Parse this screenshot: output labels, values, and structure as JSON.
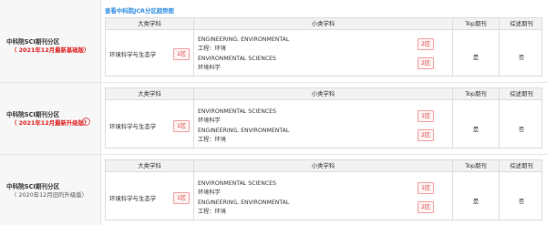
{
  "trend_link": "查看中科院JCR分区趋势图",
  "headers": {
    "major": "大类学科",
    "minor": "小类学科",
    "top": "Top期刊",
    "review": "综述期刊"
  },
  "rows": [
    {
      "title": "中科院SCI期刊分区",
      "subtitle": "（ 2021年12月最新基础版）",
      "major": "环境科学与生态学",
      "major_zone": "1区",
      "minors": [
        {
          "en": "ENGINEERING, ENVIRONMENTAL",
          "cn": "工程：环境",
          "zone": "2区"
        },
        {
          "en": "ENVIRONMENTAL SCIENCES",
          "cn": "环境科学",
          "zone": "2区"
        }
      ],
      "top": "是",
      "review": "否"
    },
    {
      "title": "中科院SCI期刊分区",
      "subtitle": "（ 2021年12月最新升级版）",
      "info_icon": "i",
      "major": "环境科学与生态学",
      "major_zone": "1区",
      "minors": [
        {
          "en": "ENVIRONMENTAL SCIENCES",
          "cn": "环境科学",
          "zone": "1区"
        },
        {
          "en": "ENGINEERING, ENVIRONMENTAL",
          "cn": "工程：环境",
          "zone": "2区"
        }
      ],
      "top": "是",
      "review": "否"
    },
    {
      "title": "中科院SCI期刊分区",
      "subtitle": "（ 2020年12月旧的升级版）",
      "major": "环境科学与生态学",
      "major_zone": "1区",
      "minors": [
        {
          "en": "ENVIRONMENTAL SCIENCES",
          "cn": "环境科学",
          "zone": "1区"
        },
        {
          "en": "ENGINEERING, ENVIRONMENTAL",
          "cn": "工程：环境",
          "zone": "2区"
        }
      ],
      "top": "是",
      "review": "否"
    }
  ]
}
